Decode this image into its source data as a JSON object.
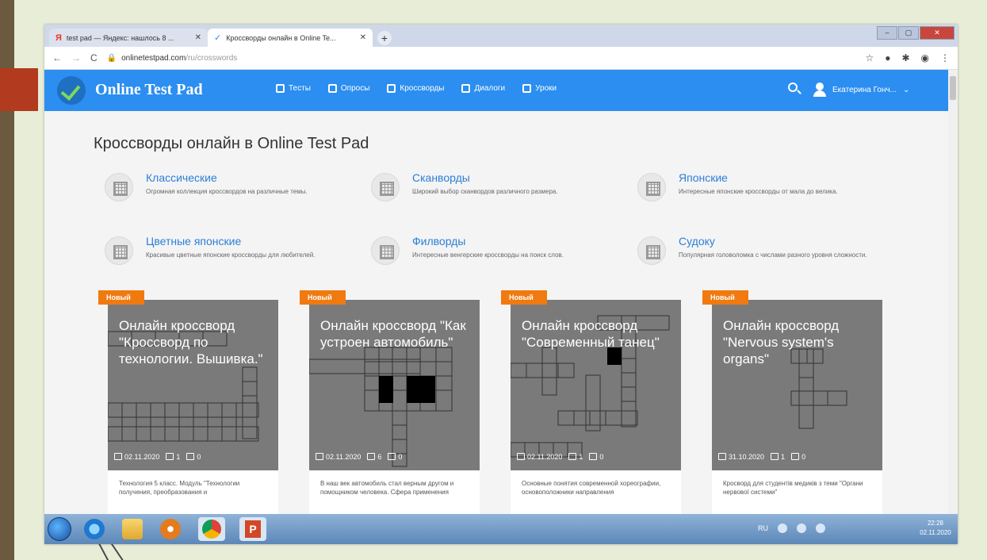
{
  "browser": {
    "tabs": [
      {
        "title": "test pad — Яндекс: нашлось 8 ..."
      },
      {
        "title": "Кроссворды онлайн в Online Te..."
      }
    ],
    "url_domain": "onlinetestpad.com",
    "url_path": "/ru/crosswords"
  },
  "site": {
    "brand": "Online Test Pad",
    "nav": [
      {
        "label": "Тесты",
        "icon": "test-icon"
      },
      {
        "label": "Опросы",
        "icon": "poll-icon"
      },
      {
        "label": "Кроссворды",
        "icon": "crossword-icon"
      },
      {
        "label": "Диалоги",
        "icon": "dialog-icon"
      },
      {
        "label": "Уроки",
        "icon": "lesson-icon"
      }
    ],
    "user_name": "Екатерина Гонч..."
  },
  "page": {
    "title": "Кроссворды онлайн в Online Test Pad",
    "categories": [
      {
        "title": "Классические",
        "desc": "Огромная коллекция кроссвордов на различные темы."
      },
      {
        "title": "Сканворды",
        "desc": "Широкий выбор сканвордов различного размера."
      },
      {
        "title": "Японские",
        "desc": "Интересные японские кроссворды от мала до велика."
      },
      {
        "title": "Цветные японские",
        "desc": "Красивые цветные японские кроссворды для любителей."
      },
      {
        "title": "Филворды",
        "desc": "Интересные венгерские кроссворды на поиск слов."
      },
      {
        "title": "Судоку",
        "desc": "Популярная головоломка с числами разного уровня сложности."
      }
    ],
    "cards": [
      {
        "badge": "Новый",
        "title": "Онлайн кроссворд \"Кроссворд по технологии. Вышивка.\"",
        "date": "02.11.2020",
        "users": "1",
        "count": "0",
        "desc": "Технология 5 класс. Модуль \"Технологии получения, преобразования и"
      },
      {
        "badge": "Новый",
        "title": "Онлайн кроссворд \"Как устроен автомобиль\"",
        "date": "02.11.2020",
        "users": "6",
        "count": "0",
        "desc": "В наш век автомобиль стал верным другом и помощником человека. Сфера применения"
      },
      {
        "badge": "Новый",
        "title": "Онлайн кроссворд \"Современный танец\"",
        "date": "02.11.2020",
        "users": "1",
        "count": "0",
        "desc": "Основные понятия современной хореографии, основоположники направления"
      },
      {
        "badge": "Новый",
        "title": "Онлайн кроссворд \"Nervous system's organs\"",
        "date": "31.10.2020",
        "users": "1",
        "count": "0",
        "desc": "Кросворд для студентів медиків з теми \"Органи нервової системи\""
      }
    ]
  },
  "taskbar": {
    "lang": "RU",
    "time": "22:28",
    "date": "02.11.2020"
  }
}
